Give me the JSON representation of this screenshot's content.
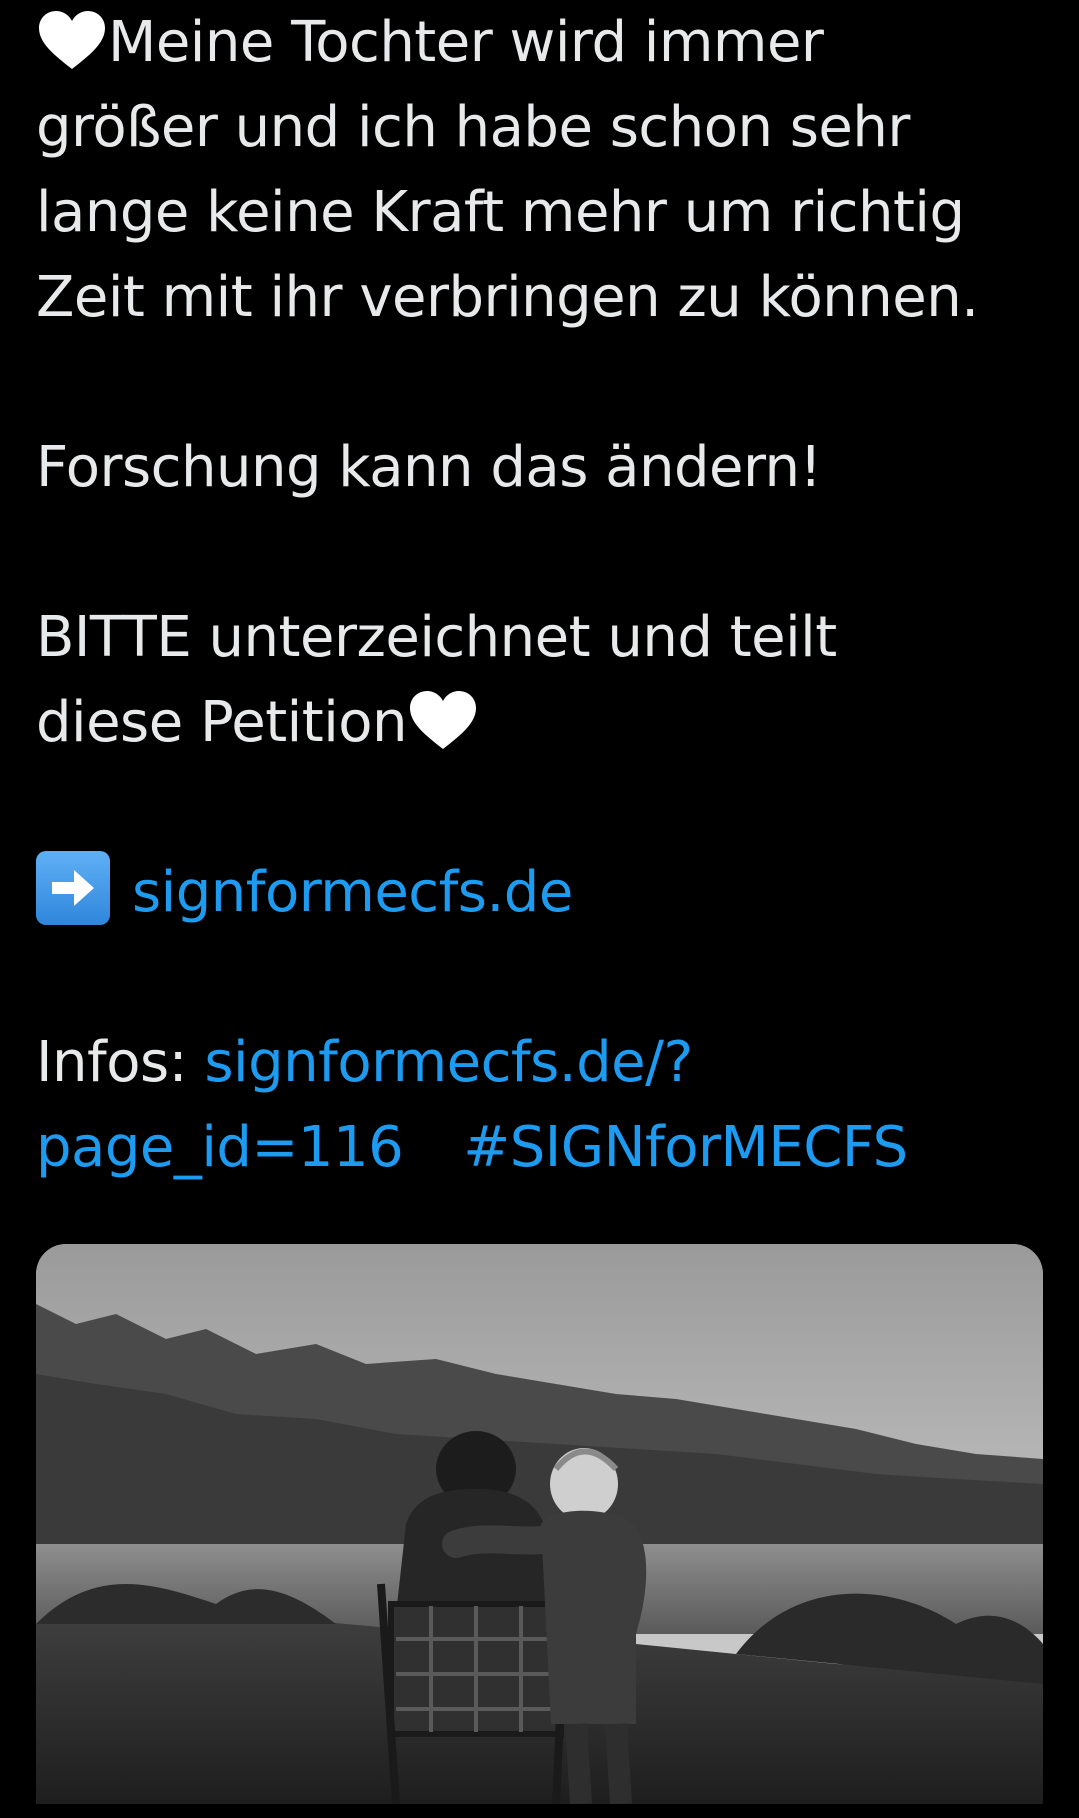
{
  "tweet": {
    "line1": "Meine Tochter wird immer",
    "line2": "größer und ich habe schon sehr",
    "line3": "lange keine Kraft mehr um richtig",
    "line4": "Zeit mit ihr verbringen zu können.",
    "line5": "Forschung kann das ändern!",
    "line6": "BITTE unterzeichnet und teilt",
    "line7": "diese Petition",
    "link_main": "signformecfs.de",
    "infos_label": "Infos: ",
    "infos_link_part1": "signformecfs.de/?",
    "infos_link_part2": "page_id=116",
    "hashtag": "#SIGNforMECFS"
  },
  "icons": {
    "heart": "white-heart-icon",
    "arrow": "right-arrow-emoji-icon"
  },
  "colors": {
    "background": "#000000",
    "text": "#e7e9ea",
    "link": "#1d9bf0",
    "arrow_bg": "#3b8fe0"
  }
}
